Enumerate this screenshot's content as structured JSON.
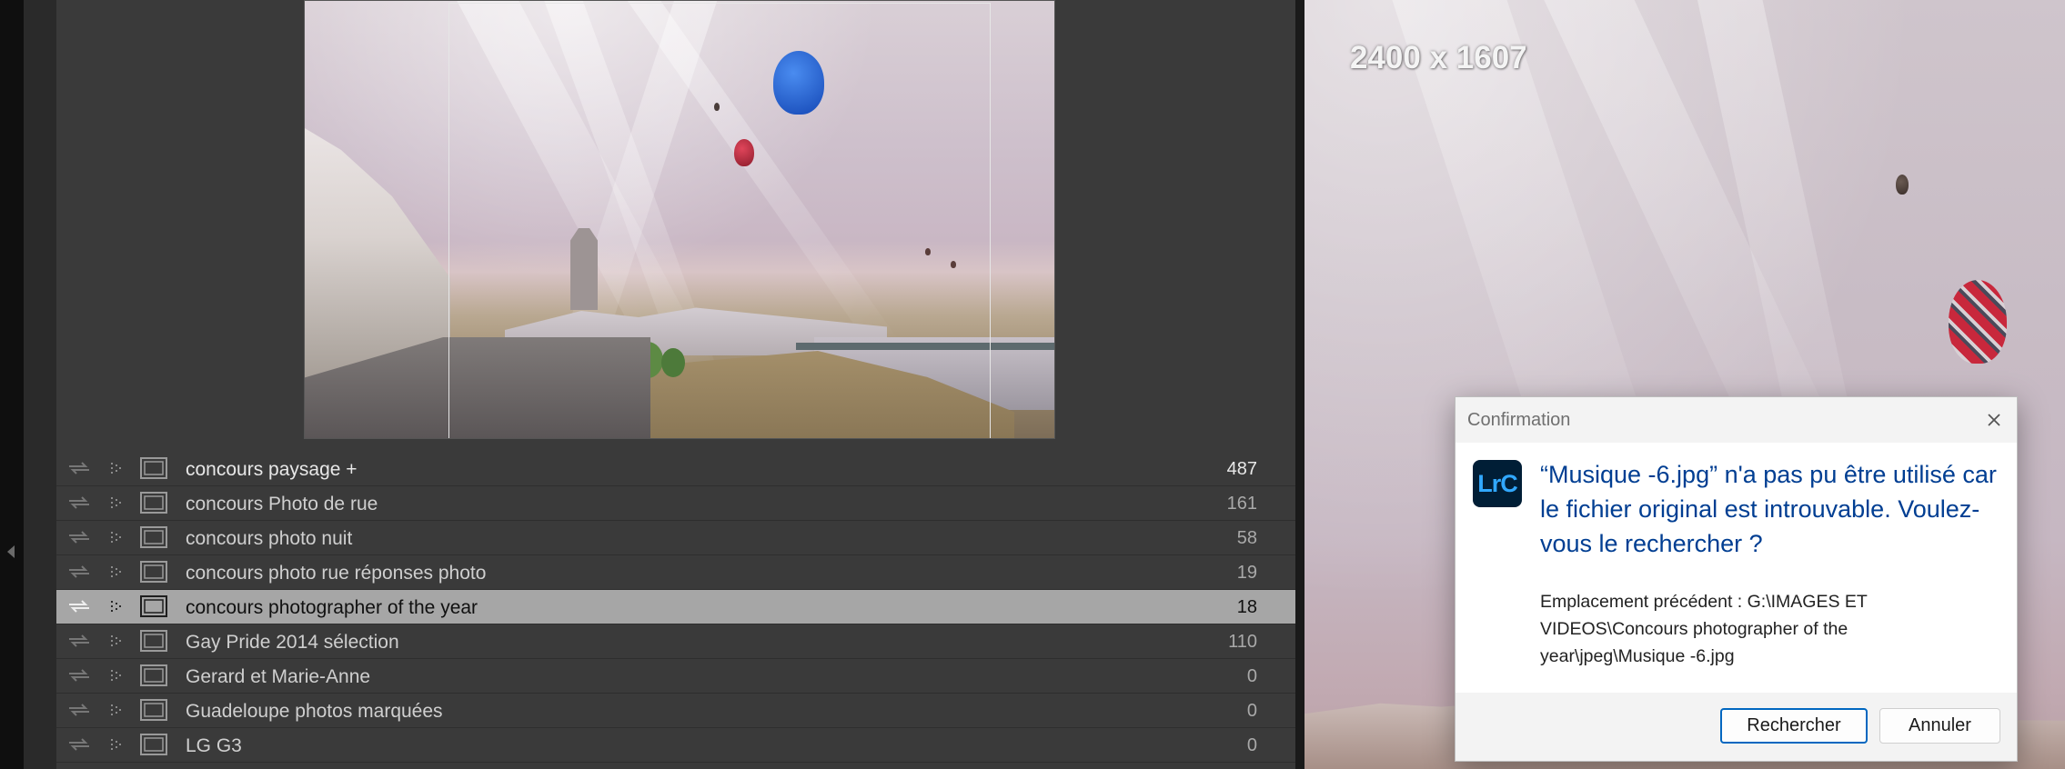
{
  "preview": {
    "image_description_hidden": ""
  },
  "collections": [
    {
      "name": "concours paysage +",
      "count": "487"
    },
    {
      "name": "concours Photo de rue",
      "count": "161"
    },
    {
      "name": "concours photo nuit",
      "count": "58"
    },
    {
      "name": "concours photo rue réponses photo",
      "count": "19"
    },
    {
      "name": "concours photographer of the year",
      "count": "18",
      "selected": true
    },
    {
      "name": "Gay Pride 2014 sélection",
      "count": "110"
    },
    {
      "name": "Gerard et Marie-Anne",
      "count": "0"
    },
    {
      "name": "Guadeloupe photos marquées",
      "count": "0"
    },
    {
      "name": "LG G3",
      "count": "0"
    }
  ],
  "loupe": {
    "dimensions": "2400 x 1607"
  },
  "dialog": {
    "title": "Confirmation",
    "app_logo": "LrC",
    "heading": "“Musique -6.jpg” n'a pas pu être utilisé car le fichier original est introuvable. Voulez-vous le rechercher ?",
    "body": "Emplacement précédent : G:\\IMAGES ET VIDEOS\\Concours photographer of the year\\jpeg\\Musique -6.jpg",
    "search_label": "Rechercher",
    "cancel_label": "Annuler"
  },
  "colors": {
    "dialog_heading": "#003e92",
    "selected_row": "#a6a6a6",
    "panel_bg": "#3a3a3a",
    "primary_button_border": "#0067c0"
  },
  "icons": [
    "sync-arrows-icon",
    "dotted-grid-icon",
    "collection-icon",
    "close-icon",
    "collapse-arrow-icon"
  ]
}
